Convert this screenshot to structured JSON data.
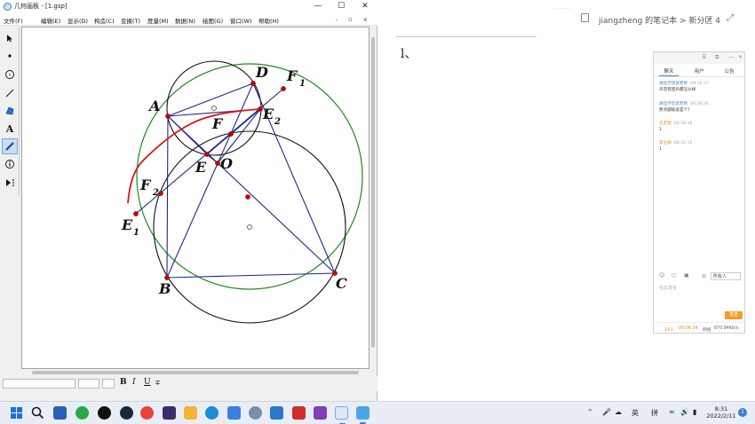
{
  "gsp": {
    "title": "几何画板 - [1.gsp]",
    "window_buttons": [
      "—",
      "☐",
      "✕"
    ],
    "menu": [
      "文件(F)",
      "编辑(E)",
      "显示(D)",
      "构造(C)",
      "变换(T)",
      "度量(M)",
      "数据(N)",
      "绘图(G)",
      "窗口(W)",
      "帮助(H)"
    ],
    "doc_buttons": "- ▫ ×",
    "tools": [
      "arrow-tool",
      "point-tool",
      "compass-tool",
      "line-tool",
      "polygon-tool",
      "text-tool",
      "marker-tool",
      "info-tool",
      "custom-tool"
    ],
    "text_format": {
      "bold": "B",
      "italic": "I",
      "underline": "U"
    }
  },
  "figure": {
    "labels": {
      "A": "A",
      "B": "B",
      "C": "C",
      "D": "D",
      "E": "E",
      "F": "F",
      "O": "O",
      "E2": "E",
      "F1": "F",
      "F2": "F",
      "E1": "E",
      "sub1": "1",
      "sub2": "2"
    },
    "colors": {
      "segment": "#1d2a86",
      "outer_circle": "#1f8a1f",
      "circle": "#111111",
      "trace": "#e01010",
      "point": "#cc0000"
    }
  },
  "notes": {
    "breadcrumb": "jiangzheng 的笔记本 > 新分区 4",
    "content_text": "l、",
    "header_ellipsis": "......"
  },
  "chat": {
    "top_icons": [
      "☰",
      "⧉",
      "—",
      "×"
    ],
    "tabs": [
      "聊天",
      "用户",
      "公告"
    ],
    "messages": [
      {
        "name": "湖北学堂武老师",
        "time": "08:26:37",
        "text": "声音有回声都怎么样",
        "name_color": "blue"
      },
      {
        "name": "湖北学堂武老师",
        "time": "08:28:36",
        "text": "原点圆轨迹是个?",
        "name_color": "blue"
      },
      {
        "name": "王宏刚",
        "time": "08:28:38",
        "text": "1",
        "name_color": "orange"
      },
      {
        "name": "李立娟",
        "time": "08:31:10",
        "text": "1",
        "name_color": "orange"
      }
    ],
    "to_label": "对",
    "to_value": "所有人",
    "input_placeholder": "在此发言",
    "send_label": "发送",
    "footer": {
      "count": "24人",
      "timer": "00:06:34",
      "delay_label": "网络",
      "speed": "870.94Kb/s"
    }
  },
  "taskbar": {
    "tray": {
      "ime1": "英",
      "ime2": "拼"
    },
    "time": "8:31",
    "date": "2022/2/11",
    "notification_count": "1"
  }
}
